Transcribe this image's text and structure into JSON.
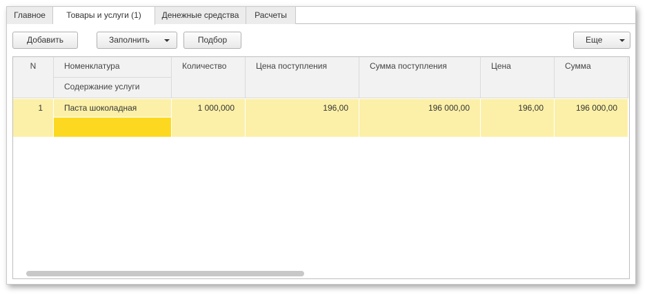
{
  "tabs": [
    {
      "label": "Главное"
    },
    {
      "label": "Товары и услуги (1)"
    },
    {
      "label": "Денежные средства"
    },
    {
      "label": "Расчеты"
    }
  ],
  "toolbar": {
    "add": "Добавить",
    "fill": "Заполнить",
    "select": "Подбор",
    "more": "Еще"
  },
  "table": {
    "headers": {
      "n": "N",
      "nomenclature": "Номенклатура",
      "service": "Содержание услуги",
      "qty": "Количество",
      "price_in": "Цена поступления",
      "sum_in": "Сумма поступления",
      "price": "Цена",
      "sum": "Сумма"
    },
    "rows": [
      {
        "n": "1",
        "nomenclature": "Паста шоколадная",
        "service": "",
        "qty": "1 000,000",
        "price_in": "196,00",
        "sum_in": "196 000,00",
        "price": "196,00",
        "sum": "196 000,00"
      }
    ]
  },
  "colors": {
    "row": "#fcf0a8",
    "active_cell": "#fcd920"
  }
}
